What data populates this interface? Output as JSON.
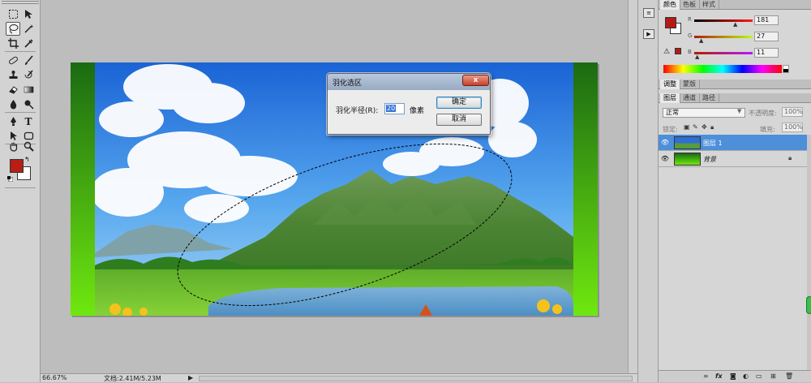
{
  "toolbar": {
    "icons": [
      "marquee-icon",
      "move-icon",
      "lasso-icon",
      "magic-wand-icon",
      "crop-icon",
      "eyedropper-icon",
      "spot-heal-icon",
      "brush-icon",
      "stamp-icon",
      "history-brush-icon",
      "eraser-icon",
      "gradient-icon",
      "blur-icon",
      "dodge-icon",
      "pen-icon",
      "type-icon",
      "path-select-icon",
      "shape-icon",
      "hand-icon",
      "zoom-icon"
    ],
    "foreground_color": "#b81d17",
    "background_color": "#ffffff"
  },
  "dialog": {
    "title": "羽化选区",
    "close_label": "x",
    "feather_label": "羽化半径(R):",
    "feather_value": "20",
    "unit": "像素",
    "ok_label": "确定",
    "cancel_label": "取消"
  },
  "status": {
    "zoom": "66.67%",
    "doc_size": "文档:2.41M/5.23M",
    "arrow": "▶"
  },
  "color_panel": {
    "tabs": [
      "颜色",
      "色板",
      "样式"
    ],
    "channels": [
      {
        "label": "R",
        "value": "181",
        "color": "#b51b15"
      },
      {
        "label": "G",
        "value": "27",
        "color": "#7fbf2f"
      },
      {
        "label": "B",
        "value": "11",
        "color": "#c02bc9"
      }
    ]
  },
  "adjust_panel": {
    "tabs": [
      "调整",
      "蒙版"
    ]
  },
  "layers_panel": {
    "tabs": [
      "图层",
      "通道",
      "路径"
    ],
    "blend_mode": "正常",
    "opacity_label": "不透明度:",
    "opacity_value": "100%",
    "lock_label": "锁定:",
    "fill_label": "填充:",
    "fill_value": "100%",
    "layers": [
      {
        "name": "图层 1",
        "selected": true
      },
      {
        "name": "背景",
        "selected": false,
        "locked": true
      }
    ],
    "footer_icons": [
      "link-icon",
      "fx-icon",
      "mask-icon",
      "adjustment-icon",
      "group-icon",
      "new-layer-icon",
      "trash-icon"
    ]
  }
}
